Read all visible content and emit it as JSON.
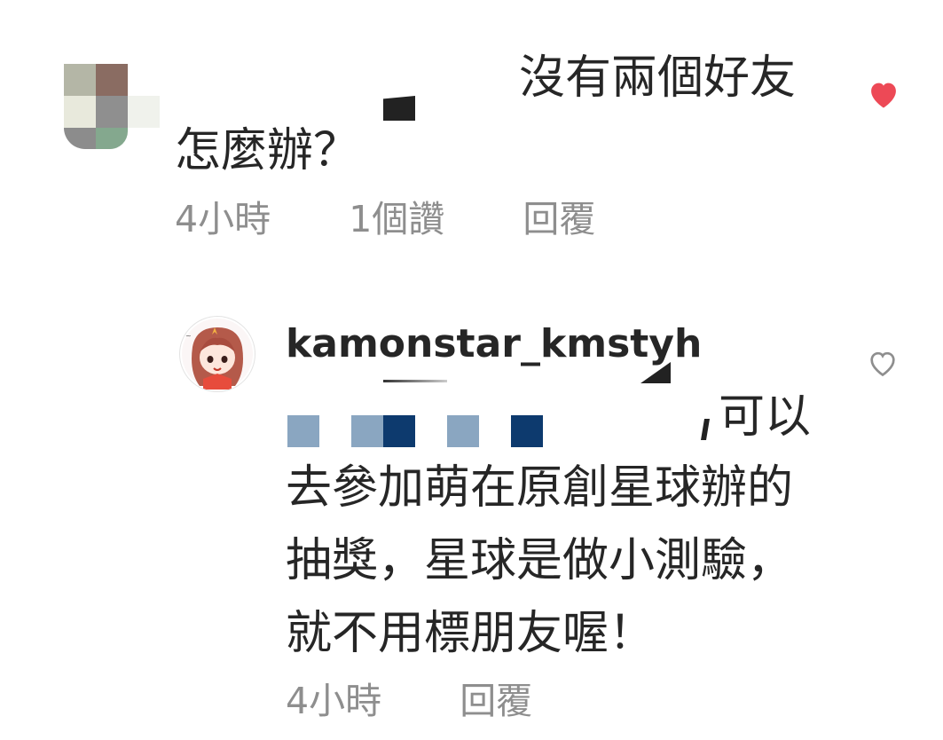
{
  "comments": [
    {
      "text_line1": "沒有兩個好友",
      "text_line2": "怎麼辦？",
      "time": "4小時",
      "likes": "1個讚",
      "reply_label": "回覆",
      "liked": true
    }
  ],
  "reply": {
    "username": "kamonstar_kmstyh",
    "text_line1": "可以",
    "text_line2": "去參加萌在原創星球辦的",
    "text_line3": "抽獎，星球是做小測驗，",
    "text_line4": "就不用標朋友喔！",
    "time": "4小時",
    "reply_label": "回覆",
    "liked": false
  },
  "colors": {
    "text": "#262626",
    "meta": "#8e8e8e",
    "heart_liked": "#ed4956",
    "heart_outline": "#8e8e8e",
    "redact_light": "#8aa6c1",
    "redact_dark": "#0d3a6e"
  },
  "icons": [
    "heart-filled-icon",
    "heart-outline-icon"
  ]
}
